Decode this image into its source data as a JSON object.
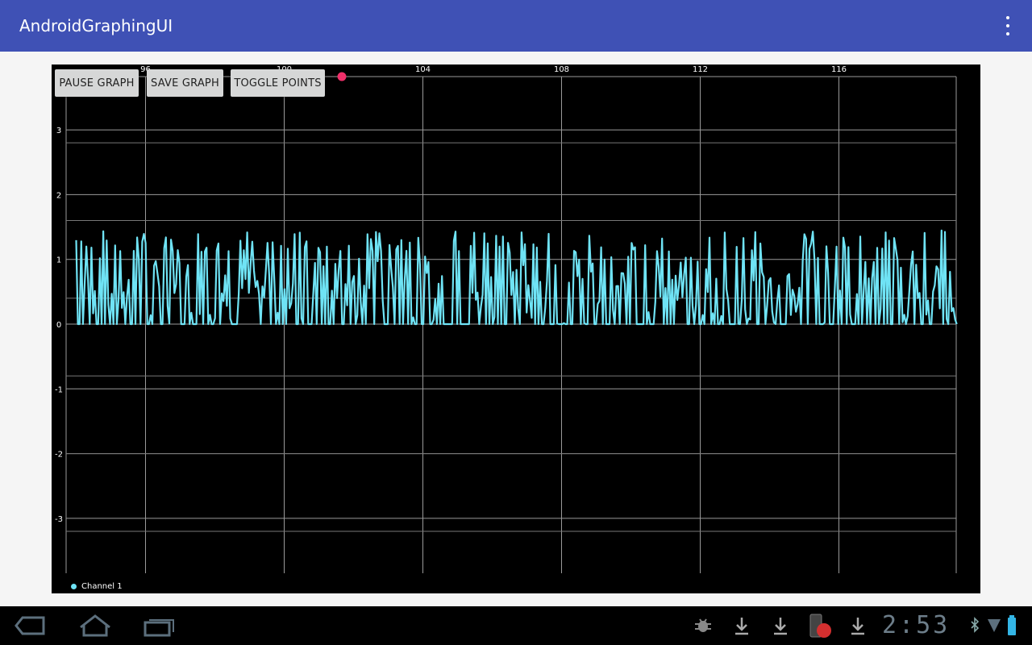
{
  "app": {
    "title": "AndroidGraphingUI"
  },
  "toolbar": {
    "pause_label": "PAUSE GRAPH",
    "save_label": "SAVE GRAPH",
    "toggle_label": "TOGGLE POINTS"
  },
  "legend": {
    "series_label": "Channel 1",
    "color": "#6fe3f5"
  },
  "status": {
    "time": "2:53"
  },
  "colors": {
    "appbar": "#3f51b5",
    "graph_bg": "#000000",
    "series": "#6fe3f5",
    "indicator": "#f0306a"
  },
  "chart_data": {
    "type": "line",
    "title": "",
    "xlabel": "",
    "ylabel": "",
    "xlim": [
      93.75,
      119.4
    ],
    "ylim": [
      -3.8,
      3.5
    ],
    "x_ticks": [
      96,
      100,
      104,
      108,
      112,
      116
    ],
    "y_ticks": [
      3,
      2,
      1,
      0,
      -1,
      -2,
      -3
    ],
    "grid": true,
    "legend_position": "bottom-left",
    "series": [
      {
        "name": "Channel 1",
        "x_range": [
          94.0,
          119.4
        ],
        "y_range": [
          0,
          1.5
        ],
        "description_of_pattern": "rapid sampled signal with spikes between 0 and ~1.45, dense oscillation"
      }
    ]
  }
}
